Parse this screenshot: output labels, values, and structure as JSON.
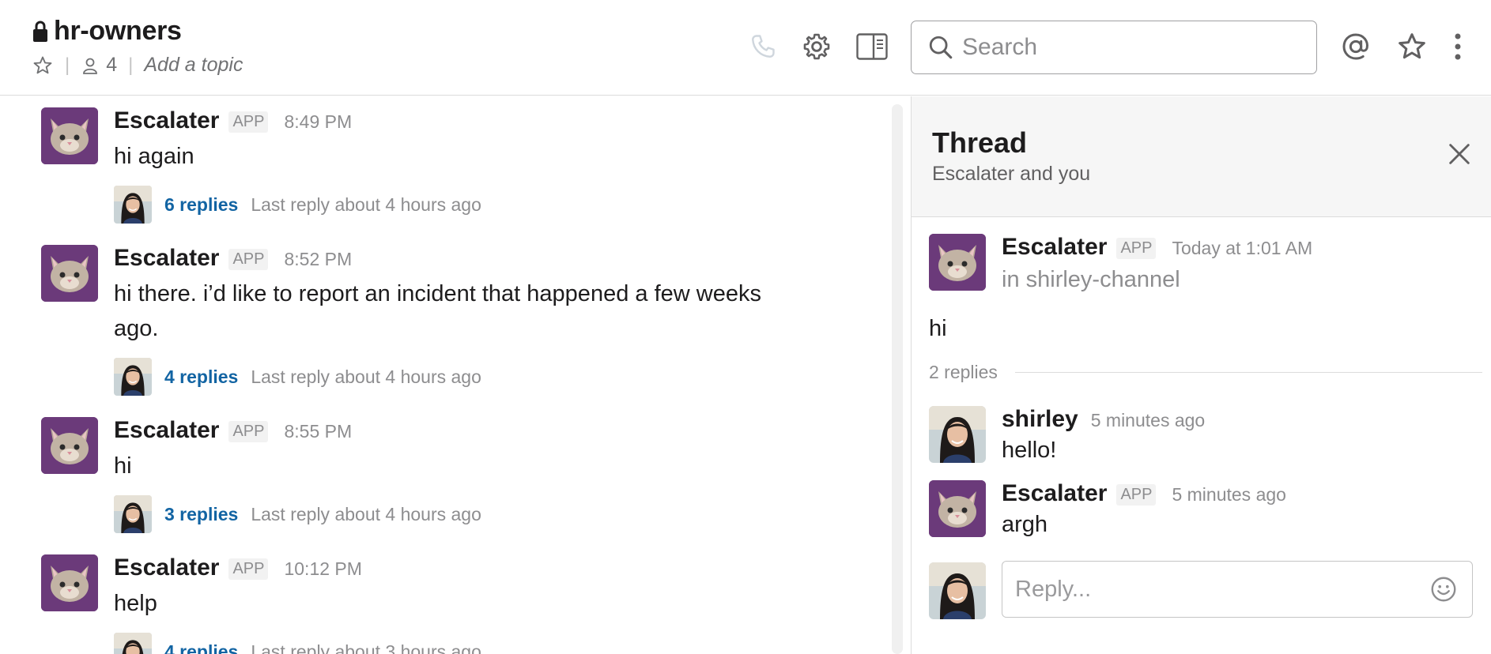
{
  "header": {
    "channel_name": "hr-owners",
    "member_count": "4",
    "topic_placeholder": "Add a topic",
    "search_placeholder": "Search"
  },
  "messages": [
    {
      "author": "Escalater",
      "badge": "APP",
      "time": "8:49 PM",
      "text": "hi again",
      "reply_count": "6 replies",
      "last_reply": "Last reply about 4 hours ago"
    },
    {
      "author": "Escalater",
      "badge": "APP",
      "time": "8:52 PM",
      "text": "hi there. i’d like to report an incident that happened a few weeks ago.",
      "reply_count": "4 replies",
      "last_reply": "Last reply about 4 hours ago"
    },
    {
      "author": "Escalater",
      "badge": "APP",
      "time": "8:55 PM",
      "text": "hi",
      "reply_count": "3 replies",
      "last_reply": "Last reply about 4 hours ago"
    },
    {
      "author": "Escalater",
      "badge": "APP",
      "time": "10:12 PM",
      "text": "help",
      "reply_count": "4 replies",
      "last_reply": "Last reply about 3 hours ago"
    }
  ],
  "thread": {
    "title": "Thread",
    "subtitle": "Escalater and you",
    "parent": {
      "author": "Escalater",
      "badge": "APP",
      "time": "Today at 1:01 AM",
      "channel": "in shirley-channel",
      "text": "hi"
    },
    "replies_label": "2 replies",
    "replies": [
      {
        "author": "shirley",
        "time": "5 minutes ago",
        "text": "hello!"
      },
      {
        "author": "Escalater",
        "badge": "APP",
        "time": "5 minutes ago",
        "text": "argh"
      }
    ],
    "reply_placeholder": "Reply..."
  },
  "colors": {
    "accent_link": "#1264a3",
    "bot_avatar_bg": "#6b3a7a"
  }
}
